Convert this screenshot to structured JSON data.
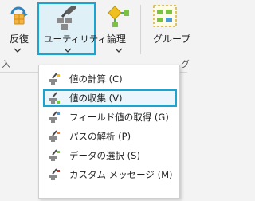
{
  "ribbon": {
    "iterate_label": "反復",
    "utility_label": "ユーティリティ",
    "logic_label": "論理",
    "group_label": "グループ",
    "group_caption_left": "入",
    "group_caption_right": "グ"
  },
  "menu": {
    "items": [
      {
        "label": "値の計算 (C)",
        "icon": "calculate-value-icon"
      },
      {
        "label": "値の収集 (V)",
        "icon": "collect-values-icon"
      },
      {
        "label": "フィールド値の取得 (G)",
        "icon": "get-field-value-icon"
      },
      {
        "label": "パスの解析 (P)",
        "icon": "parse-path-icon"
      },
      {
        "label": "データの選択 (S)",
        "icon": "select-data-icon"
      },
      {
        "label": "カスタム メッセージ (M)",
        "icon": "custom-message-icon"
      }
    ]
  },
  "colors": {
    "accent": "#1aa4d1",
    "ribbon_bg": "#f3f3f3",
    "menu_bg": "#ffffff",
    "highlight_bg": "#eaf6fb"
  }
}
